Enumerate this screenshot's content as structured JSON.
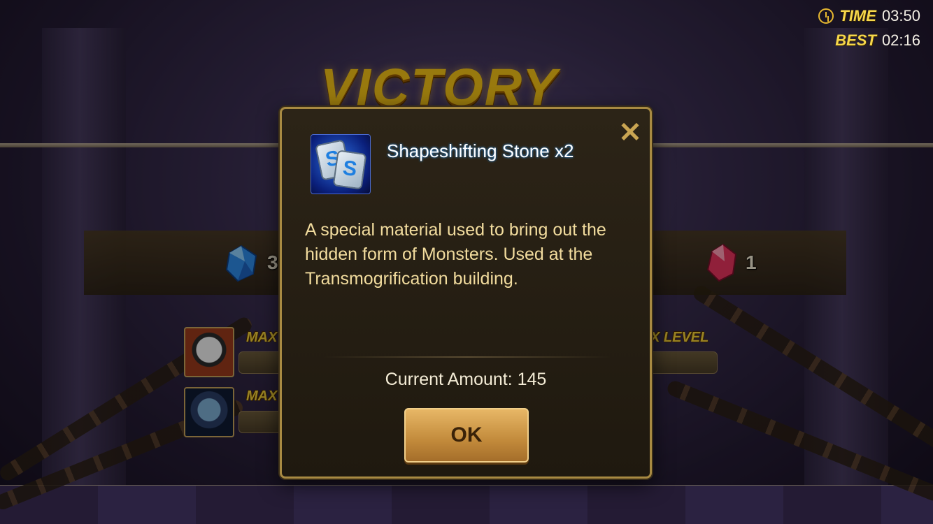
{
  "timer": {
    "time_label": "TIME",
    "time_value": "03:50",
    "best_label": "BEST",
    "best_value": "02:16"
  },
  "banner": {
    "title": "VICTORY"
  },
  "rewards": {
    "crystal_count": "3",
    "rune_count": "1"
  },
  "monsters": [
    {
      "status": "MAX"
    },
    {
      "status": "MAX"
    }
  ],
  "right_status": "X LEVEL",
  "modal": {
    "close_symbol": "✕",
    "item_title": "Shapeshifting Stone x2",
    "description": "A special material used to bring out the hidden form of Monsters. Used at the Transmogrification building.",
    "current_amount": "Current Amount: 145",
    "ok_label": "OK"
  },
  "colors": {
    "accent_gold": "#f5c318",
    "modal_border": "#a88a42",
    "description_text": "#f2dc9e"
  }
}
